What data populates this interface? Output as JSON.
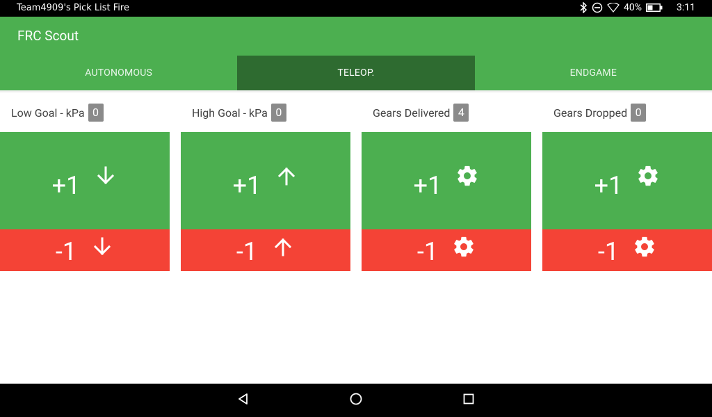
{
  "status_bar": {
    "notification": "Team4909's Pick List Fire",
    "battery": "40%",
    "time": "3:11"
  },
  "app": {
    "title": "FRC Scout"
  },
  "tabs": [
    {
      "label": "AUTONOMOUS",
      "active": false
    },
    {
      "label": "TELEOP.",
      "active": true
    },
    {
      "label": "ENDGAME",
      "active": false
    }
  ],
  "counters": [
    {
      "label": "Low Goal - kPa",
      "count": "0",
      "plus_label": "+1",
      "minus_label": "-1",
      "icon": "arrow-down-icon"
    },
    {
      "label": "High Goal - kPa",
      "count": "0",
      "plus_label": "+1",
      "minus_label": "-1",
      "icon": "arrow-up-icon"
    },
    {
      "label": "Gears Delivered",
      "count": "4",
      "plus_label": "+1",
      "minus_label": "-1",
      "icon": "gear-icon"
    },
    {
      "label": "Gears Dropped",
      "count": "0",
      "plus_label": "+1",
      "minus_label": "-1",
      "icon": "gear-icon"
    }
  ],
  "colors": {
    "primary": "#4caf50",
    "primary_dark": "#2e6b30",
    "decrement": "#f44336",
    "badge": "#8a8a8a"
  }
}
